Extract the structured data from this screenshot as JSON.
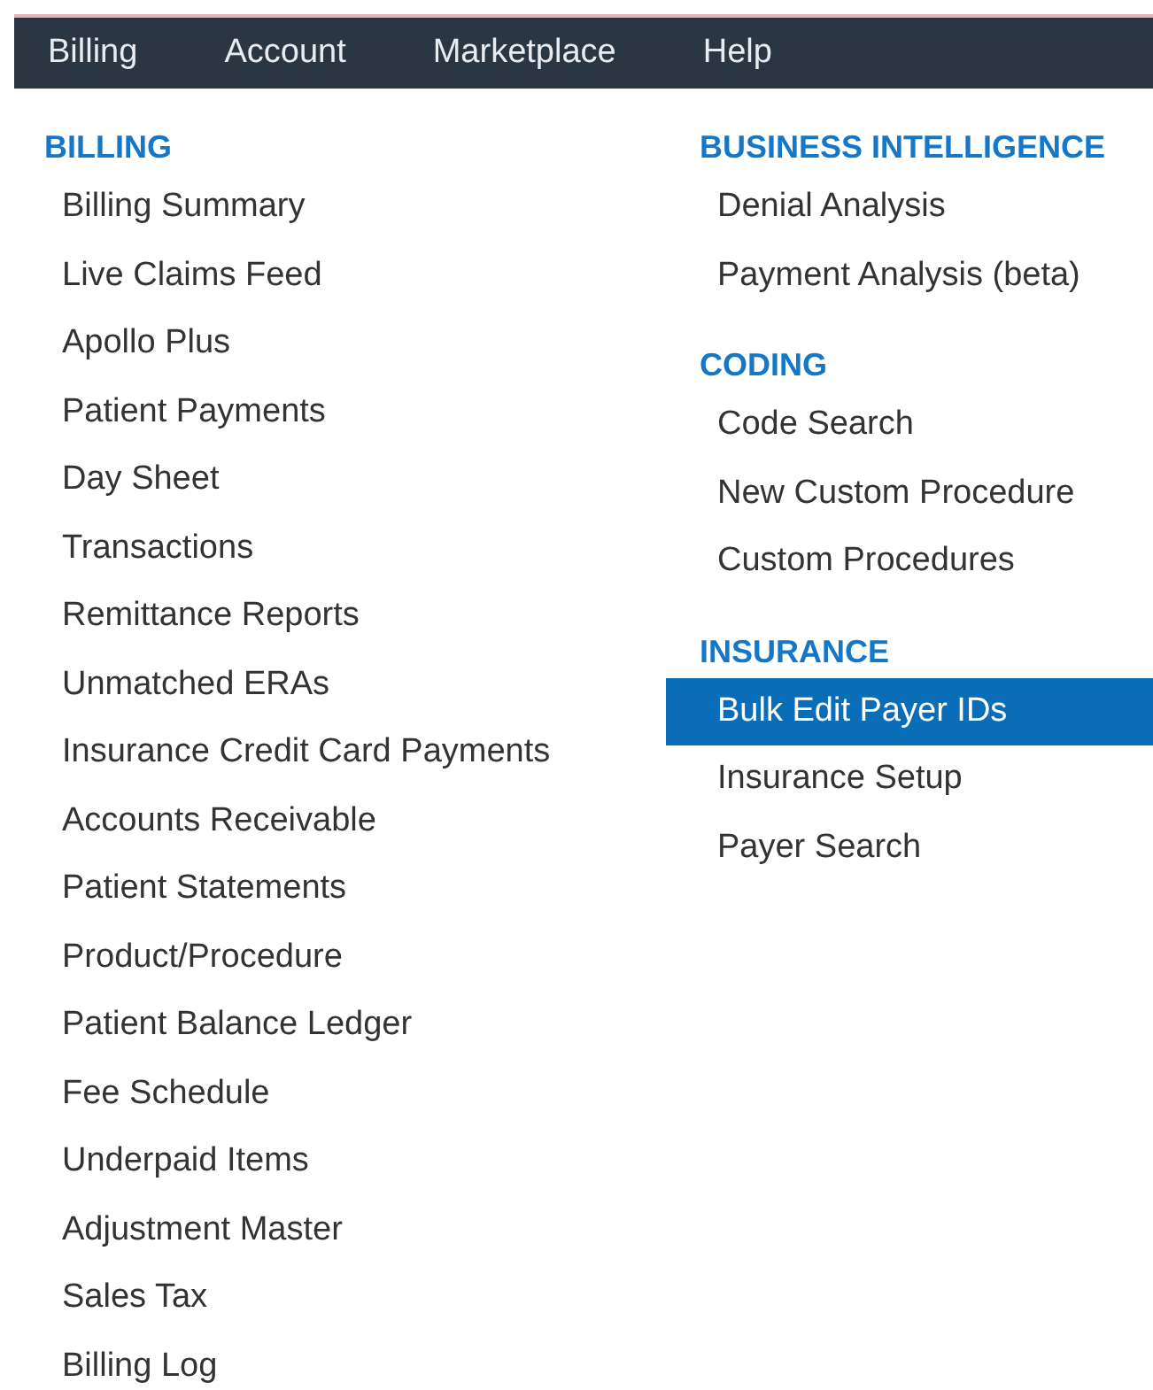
{
  "menu_bar": [
    {
      "label": "Billing"
    },
    {
      "label": "Account"
    },
    {
      "label": "Marketplace"
    },
    {
      "label": "Help"
    }
  ],
  "columns": [
    [
      {
        "heading": "BILLING",
        "items": [
          {
            "label": "Billing Summary",
            "selected": false
          },
          {
            "label": "Live Claims Feed",
            "selected": false
          },
          {
            "label": "Apollo Plus",
            "selected": false
          },
          {
            "label": "Patient Payments",
            "selected": false
          },
          {
            "label": "Day Sheet",
            "selected": false
          },
          {
            "label": "Transactions",
            "selected": false
          },
          {
            "label": "Remittance Reports",
            "selected": false
          },
          {
            "label": "Unmatched ERAs",
            "selected": false
          },
          {
            "label": "Insurance Credit Card Payments",
            "selected": false
          },
          {
            "label": "Accounts Receivable",
            "selected": false
          },
          {
            "label": "Patient Statements",
            "selected": false
          },
          {
            "label": "Product/Procedure",
            "selected": false
          },
          {
            "label": "Patient Balance Ledger",
            "selected": false
          },
          {
            "label": "Fee Schedule",
            "selected": false
          },
          {
            "label": "Underpaid Items",
            "selected": false
          },
          {
            "label": "Adjustment Master",
            "selected": false
          },
          {
            "label": "Sales Tax",
            "selected": false
          },
          {
            "label": "Billing Log",
            "selected": false
          }
        ]
      }
    ],
    [
      {
        "heading": "BUSINESS INTELLIGENCE",
        "items": [
          {
            "label": "Denial Analysis",
            "selected": false
          },
          {
            "label": "Payment Analysis (beta)",
            "selected": false
          }
        ]
      },
      {
        "heading": "CODING",
        "items": [
          {
            "label": "Code Search",
            "selected": false
          },
          {
            "label": "New Custom Procedure",
            "selected": false
          },
          {
            "label": "Custom Procedures",
            "selected": false
          }
        ]
      },
      {
        "heading": "INSURANCE",
        "items": [
          {
            "label": "Bulk Edit Payer IDs",
            "selected": true
          },
          {
            "label": "Insurance Setup",
            "selected": false
          },
          {
            "label": "Payer Search",
            "selected": false
          }
        ]
      }
    ]
  ]
}
